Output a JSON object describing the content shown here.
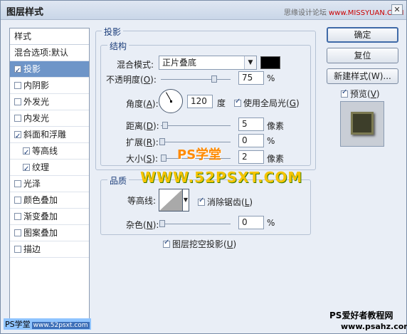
{
  "window": {
    "title": "图层样式",
    "close_glyph": "✕"
  },
  "watermark_top": {
    "text": "思缘设计论坛",
    "url": "www.MISSYUAN.COM"
  },
  "left_panel": {
    "header": "样式",
    "items": [
      {
        "label": "混合选项:默认",
        "checkbox": false,
        "checked": false,
        "selected": false,
        "indent": false
      },
      {
        "label": "投影",
        "checkbox": true,
        "checked": true,
        "selected": true,
        "indent": false
      },
      {
        "label": "内阴影",
        "checkbox": true,
        "checked": false,
        "selected": false,
        "indent": false
      },
      {
        "label": "外发光",
        "checkbox": true,
        "checked": false,
        "selected": false,
        "indent": false
      },
      {
        "label": "内发光",
        "checkbox": true,
        "checked": false,
        "selected": false,
        "indent": false
      },
      {
        "label": "斜面和浮雕",
        "checkbox": true,
        "checked": true,
        "selected": false,
        "indent": false
      },
      {
        "label": "等高线",
        "checkbox": true,
        "checked": true,
        "selected": false,
        "indent": true
      },
      {
        "label": "纹理",
        "checkbox": true,
        "checked": true,
        "selected": false,
        "indent": true
      },
      {
        "label": "光泽",
        "checkbox": true,
        "checked": false,
        "selected": false,
        "indent": false
      },
      {
        "label": "颜色叠加",
        "checkbox": true,
        "checked": false,
        "selected": false,
        "indent": false
      },
      {
        "label": "渐变叠加",
        "checkbox": true,
        "checked": false,
        "selected": false,
        "indent": false
      },
      {
        "label": "图案叠加",
        "checkbox": true,
        "checked": false,
        "selected": false,
        "indent": false
      },
      {
        "label": "描边",
        "checkbox": true,
        "checked": false,
        "selected": false,
        "indent": false
      }
    ]
  },
  "shadow": {
    "legend": "投影",
    "structure_legend": "结构",
    "blend_mode_label": "混合模式:",
    "blend_mode_value": "正片叠底",
    "shadow_color": "#000000",
    "opacity": {
      "label": "不透明度",
      "key": "O",
      "value": "75",
      "unit": "%"
    },
    "angle": {
      "label": "角度",
      "key": "A",
      "value": "120",
      "unit": "度"
    },
    "global_light": {
      "label": "使用全局光",
      "key": "G",
      "checked": true
    },
    "distance": {
      "label": "距离",
      "key": "D",
      "value": "5",
      "unit": "像素"
    },
    "spread": {
      "label": "扩展",
      "key": "R",
      "value": "0",
      "unit": "%"
    },
    "size": {
      "label": "大小",
      "key": "S",
      "value": "2",
      "unit": "像素"
    }
  },
  "quality": {
    "legend": "品质",
    "contour_label": "等高线:",
    "anti_alias": {
      "label": "消除锯齿",
      "key": "L",
      "checked": true
    },
    "noise": {
      "label": "杂色",
      "key": "N",
      "value": "0",
      "unit": "%"
    }
  },
  "knockout": {
    "label": "图层挖空投影",
    "key": "U",
    "checked": true
  },
  "buttons": {
    "ok": "确定",
    "reset": "复位",
    "new_style": "新建样式(W)...",
    "preview_label": "预览",
    "preview_key": "V",
    "preview_checked": true
  },
  "overlays": {
    "ps_text": "PS学堂",
    "www_text": "WWW.52PSXT.COM",
    "bottom_left": "PS学堂",
    "bottom_left_url": "www.52psxt.com",
    "bottom_right_1": "PS爱好者教程网",
    "bottom_right_2": "www.psahz.com"
  }
}
